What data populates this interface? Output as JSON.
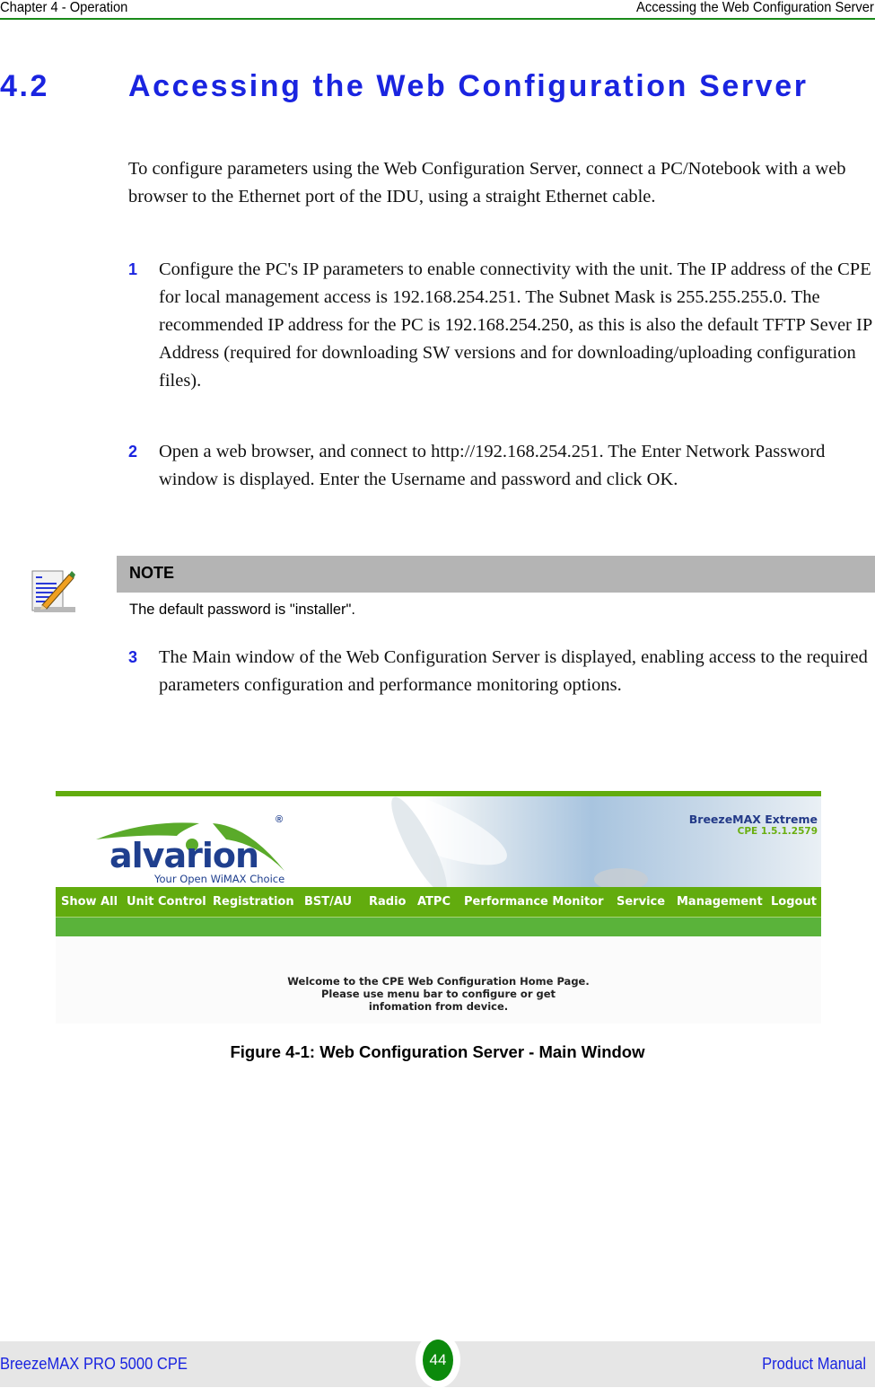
{
  "header": {
    "chapter": "Chapter 4 - Operation",
    "section_title": "Accessing the Web Configuration Server"
  },
  "section": {
    "number": "4.2",
    "title": "Accessing the Web Configuration Server"
  },
  "intro": "To configure parameters using the Web Configuration Server, connect a PC/Notebook with a web browser to the Ethernet port of the IDU, using a straight Ethernet cable.",
  "steps": [
    {
      "num": "1",
      "text": "Configure the PC's IP parameters to enable connectivity with the unit. The IP address of the CPE for local management access is 192.168.254.251. The Subnet Mask is 255.255.255.0. The recommended IP address for the PC is 192.168.254.250, as this is also the default TFTP Sever IP Address (required for downloading SW versions and for downloading/uploading configuration files)."
    },
    {
      "num": "2",
      "text": "Open a web browser, and connect to http://192.168.254.251. The Enter Network Password window is displayed. Enter the Username and password and click OK."
    },
    {
      "num": "3",
      "text": "The Main window of the Web Configuration Server is displayed, enabling access to the required parameters configuration and performance monitoring options."
    }
  ],
  "note": {
    "icon": "note-pencil-icon",
    "label": "NOTE",
    "text": "The default password is \"installer\"."
  },
  "figure": {
    "logo": {
      "word": "alvarion",
      "tagline": "Your Open WiMAX Choice",
      "registered": "®"
    },
    "product_name": "BreezeMAX Extreme",
    "product_version": "CPE 1.5.1.2579",
    "menu": [
      "Show All",
      "Unit Control",
      "Registration",
      "BST/AU",
      "Radio",
      "ATPC",
      "Performance Monitor",
      "Service",
      "Management",
      "Logout"
    ],
    "welcome_lines": [
      "Welcome to the CPE Web Configuration Home Page.",
      "Please use menu bar to configure or get",
      "infomation from device."
    ],
    "colors": {
      "menu_green": "#62ac0e",
      "subbar_green": "#5ab33a",
      "brand_blue": "#1f3f8e"
    }
  },
  "caption": "Figure 4-1: Web Configuration Server - Main Window",
  "footer": {
    "product": "BreezeMAX PRO 5000 CPE",
    "page": "44",
    "doc_type": "Product Manual"
  },
  "colors": {
    "heading_blue": "#1a24e0",
    "header_rule_green": "#1a8a1a",
    "page_badge_green": "#0c8a0c",
    "note_bar_gray": "#b4b4b4"
  }
}
